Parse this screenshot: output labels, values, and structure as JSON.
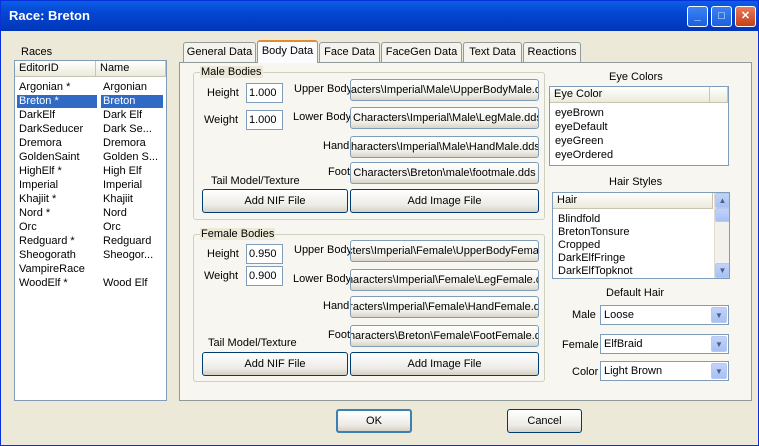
{
  "window": {
    "title": "Race: Breton"
  },
  "races": {
    "label": "Races",
    "columns": [
      "EditorID",
      "Name"
    ],
    "rows": [
      [
        "Argonian *",
        "Argonian"
      ],
      [
        "Breton *",
        "Breton"
      ],
      [
        "DarkElf",
        "Dark Elf"
      ],
      [
        "DarkSeducer",
        "Dark Se..."
      ],
      [
        "Dremora",
        "Dremora"
      ],
      [
        "GoldenSaint",
        "Golden S..."
      ],
      [
        "HighElf *",
        "High Elf"
      ],
      [
        "Imperial",
        "Imperial"
      ],
      [
        "Khajiit *",
        "Khajiit"
      ],
      [
        "Nord *",
        "Nord"
      ],
      [
        "Orc",
        "Orc"
      ],
      [
        "Redguard *",
        "Redguard"
      ],
      [
        "Sheogorath",
        "Sheogor..."
      ],
      [
        "VampireRace",
        ""
      ],
      [
        "WoodElf *",
        "Wood Elf"
      ]
    ],
    "selected_index": 1
  },
  "tabs": [
    "General Data",
    "Body Data",
    "Face Data",
    "FaceGen Data",
    "Text Data",
    "Reactions"
  ],
  "male": {
    "group": "Male Bodies",
    "height_label": "Height",
    "height": "1.000",
    "weight_label": "Weight",
    "weight": "1.000",
    "upper_label": "Upper Body",
    "upper": "Characters\\Imperial\\Male\\UpperBodyMale.dds",
    "lower_label": "Lower Body",
    "lower": "Characters\\Imperial\\Male\\LegMale.dds",
    "hand_label": "Hand",
    "hand": "Characters\\Imperial\\Male\\HandMale.dds",
    "foot_label": "Foot",
    "foot": "Characters\\Breton\\male\\footmale.dds",
    "tail_label": "Tail Model/Texture",
    "nif_button": "Add NIF File",
    "image_button": "Add Image File"
  },
  "female": {
    "group": "Female Bodies",
    "height_label": "Height",
    "height": "0.950",
    "weight_label": "Weight",
    "weight": "0.900",
    "upper_label": "Upper Body",
    "upper": "Characters\\Imperial\\Female\\UpperBodyFemale.dds",
    "lower_label": "Lower Body",
    "lower": "Characters\\Imperial\\Female\\LegFemale.dds",
    "hand_label": "Hand",
    "hand": "Characters\\Imperial\\Female\\HandFemale.dds",
    "foot_label": "Foot",
    "foot": "Characters\\Breton\\Female\\FootFemale.dds",
    "tail_label": "Tail Model/Texture",
    "nif_button": "Add NIF File",
    "image_button": "Add Image File"
  },
  "eye": {
    "label": "Eye Colors",
    "column": "Eye Color",
    "items": [
      "eyeBrown",
      "eyeDefault",
      "eyeGreen",
      "eyeOrdered"
    ]
  },
  "hair": {
    "label": "Hair Styles",
    "column": "Hair",
    "items": [
      "Blindfold",
      "BretonTonsure",
      "Cropped",
      "DarkElfFringe",
      "DarkElfTopknot"
    ]
  },
  "default_hair": {
    "label": "Default Hair",
    "male_label": "Male",
    "male": "Loose",
    "female_label": "Female",
    "female": "ElfBraid",
    "color_label": "Color",
    "color": "Light Brown"
  },
  "footer": {
    "ok": "OK",
    "cancel": "Cancel"
  }
}
